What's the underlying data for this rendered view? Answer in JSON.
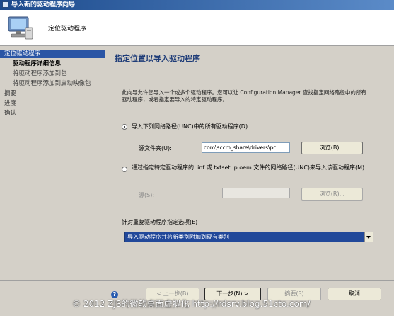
{
  "window": {
    "title": "导入新的驱动程序向导"
  },
  "header": {
    "title": "定位驱动程序",
    "icon": "computer-driver-icon"
  },
  "nav": {
    "items": [
      {
        "label": "定位驱动程序",
        "state": "active"
      },
      {
        "label": "驱动程序详细信息",
        "state": "current-sub"
      },
      {
        "label": "将驱动程序添加到包",
        "state": "sub"
      },
      {
        "label": "将驱动程序添加到启动映像包",
        "state": "sub"
      },
      {
        "label": "摘要",
        "state": "normal"
      },
      {
        "label": "进度",
        "state": "normal"
      },
      {
        "label": "确认",
        "state": "normal"
      }
    ]
  },
  "main": {
    "heading": "指定位置以导入驱动程序",
    "description": "此向导允许您导入一个或多个驱动程序。您可以让 Configuration Manager 查找指定网络路径中的所有驱动程序，或者指定要导入的特定驱动程序。",
    "option1": {
      "label": "导入下列网络路径(UNC)中的所有驱动程序(D)",
      "selected": true,
      "field_label": "源文件夹(U):",
      "field_value": "com\\sccm_share\\drivers\\pcl",
      "browse_label": "浏览(B)..."
    },
    "option2": {
      "label": "通过指定特定驱动程序的 .inf 或 txtsetup.oem 文件的网络路径(UNC)来导入该驱动程序(M)",
      "selected": false,
      "field_label": "源(S):",
      "field_value": "",
      "browse_label": "浏览(R)..."
    },
    "duplicate": {
      "label": "针对重复驱动程序指定选项(E)",
      "selected_value": "导入驱动程序并将新类别附加到现有类别"
    }
  },
  "footer": {
    "back_label": "< 上一步(B)",
    "next_label": "下一步(N) >",
    "summary_label": "摘要(S)",
    "cancel_label": "取消"
  },
  "watermark": "© 2012 ZJS的微软桌面虚拟化 http://rdsrv.blog.51cto.com/",
  "colors": {
    "accent": "#2a55a5",
    "title_bar": "#1c4a8c",
    "heading": "#1e3c78"
  }
}
